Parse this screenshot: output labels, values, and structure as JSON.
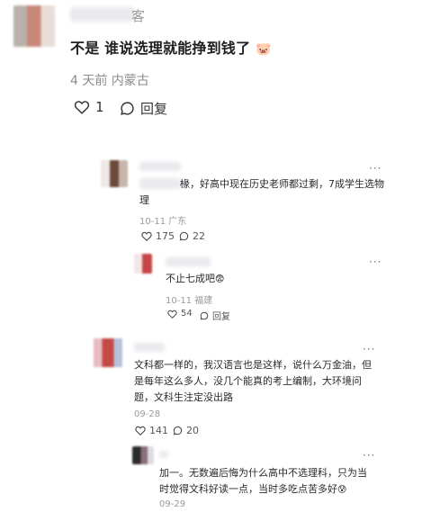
{
  "main_comment": {
    "name_suffix": "客",
    "text": "不是 谁说选理就能挣到钱了",
    "emoji": "🐷",
    "meta": "4 天前 内蒙古",
    "likes": "1",
    "reply_label": "回复"
  },
  "reply1": {
    "text_line1": "椽，好高中现在历史老师都过剩，7成学生选物",
    "text_line2": "理",
    "meta": "10-11 广东",
    "likes": "175",
    "replies": "22",
    "more": "···"
  },
  "reply1_sub": {
    "text": "不止七成吧",
    "emoji": "😨",
    "meta": "10-11 福建",
    "likes": "54",
    "reply_label": "回复",
    "more": "···"
  },
  "reply2": {
    "line1": "文科都一样的，我汉语言也是这样，说什么万金油，但",
    "line2": "是每年这么多人，没几个能真的考上编制，大环境问",
    "line3": "题，文科生注定没出路",
    "meta": "09-28",
    "likes": "141",
    "replies": "20",
    "more": "···"
  },
  "reply2_sub": {
    "line1": "加一。无数遍后悔为什么高中不选理科，只为当",
    "line2": "时觉得文科好读一点，当时多吃点苦多好",
    "emoji": "😰",
    "meta": "09-29",
    "more": "···"
  },
  "colors": {
    "text": "#1f1f1f",
    "meta": "#8c8c8c"
  }
}
